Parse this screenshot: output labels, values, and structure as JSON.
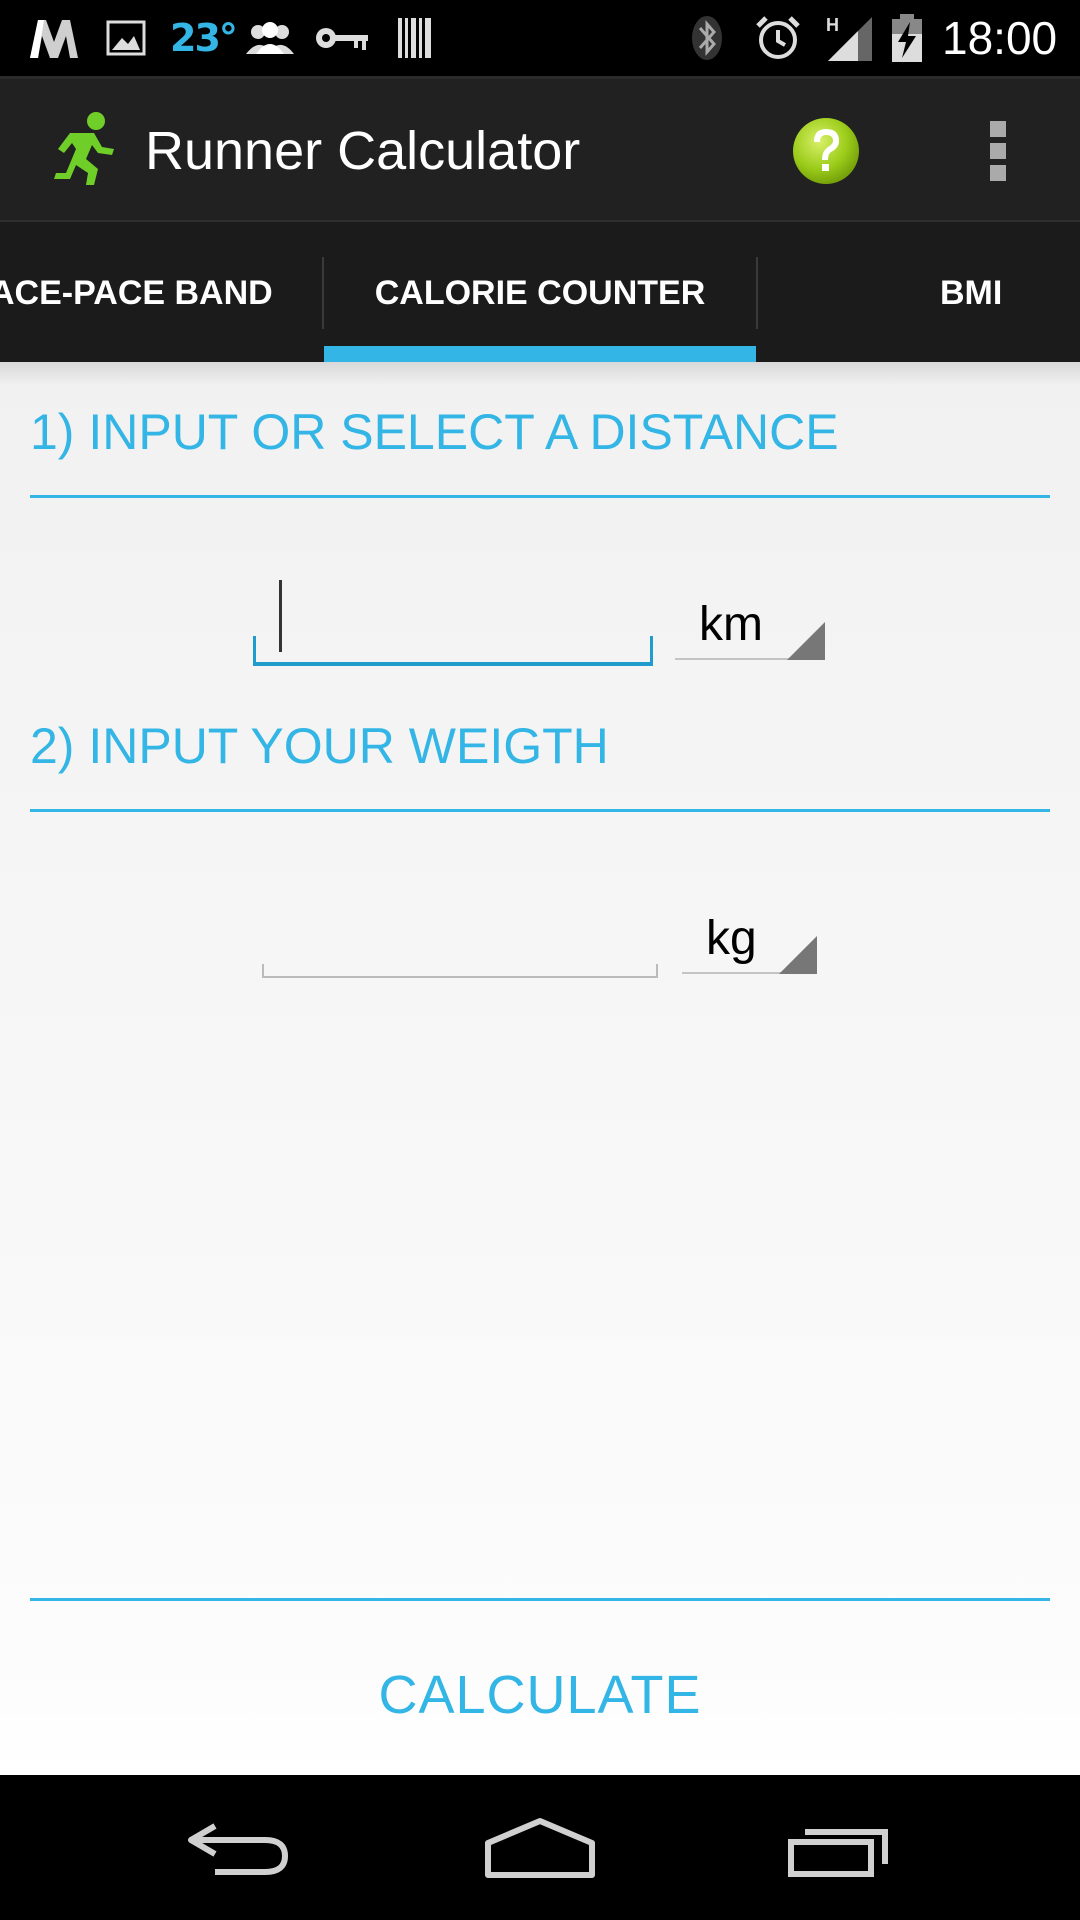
{
  "status_bar": {
    "temperature": "23°",
    "time": "18:00",
    "network_type": "H",
    "icons": [
      "m-logo-icon",
      "gallery-icon",
      "weather-temp",
      "people-icon",
      "key-icon",
      "barcode-icon",
      "bluetooth-icon",
      "alarm-icon",
      "signal-icon",
      "battery-charging-icon"
    ]
  },
  "action_bar": {
    "title": "Runner Calculator",
    "app_icon": "runner-icon",
    "help_icon": "help-icon",
    "overflow_icon": "overflow-menu-icon"
  },
  "tabs": [
    {
      "label": "ACE-PACE BAND",
      "selected": false
    },
    {
      "label": "CALORIE COUNTER",
      "selected": true
    },
    {
      "label": "BMI",
      "selected": false
    }
  ],
  "colors": {
    "accent": "#33b5e5",
    "help_green": "#9ccc1a",
    "runner_green": "#6fcf28"
  },
  "form": {
    "distance": {
      "heading": "1) INPUT OR SELECT A DISTANCE",
      "value": "",
      "unit": "km"
    },
    "weight": {
      "heading": "2) INPUT YOUR WEIGTH",
      "value": "",
      "unit": "kg"
    },
    "calculate_label": "CALCULATE"
  },
  "nav_bar": {
    "buttons": [
      "back-icon",
      "home-icon",
      "recent-apps-icon"
    ]
  }
}
